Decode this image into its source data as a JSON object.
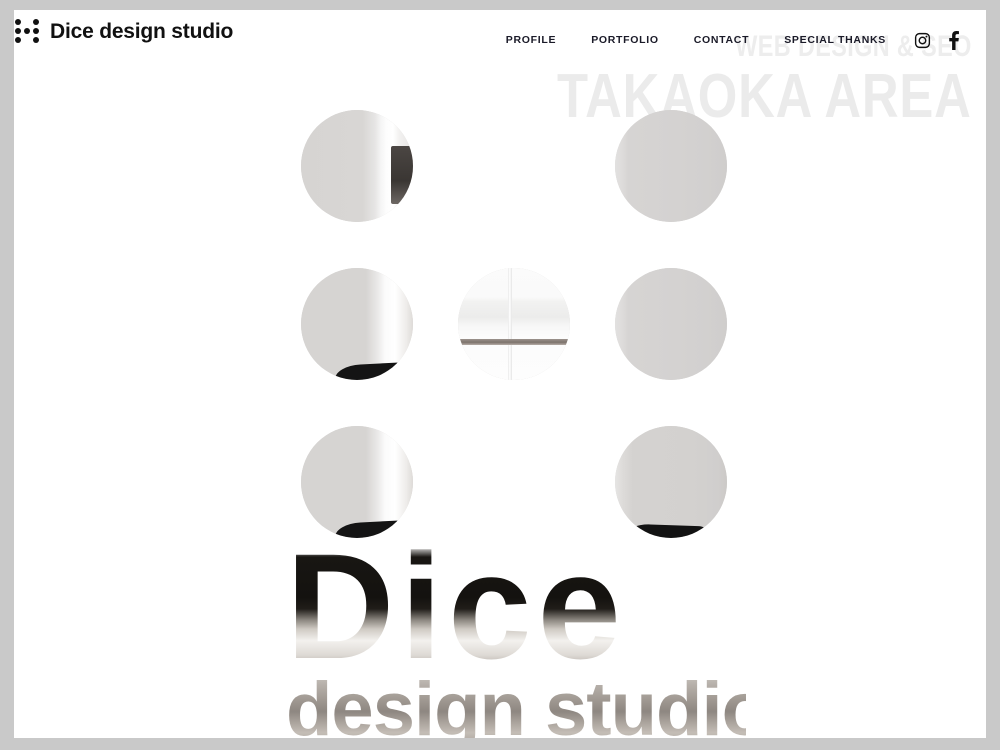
{
  "site": {
    "brand_name": "Dice design studio",
    "logo_icon": "dice-dots-icon"
  },
  "nav": {
    "items": [
      {
        "label": "PROFILE",
        "name": "nav-profile"
      },
      {
        "label": "PORTFOLIO",
        "name": "nav-portfolio"
      },
      {
        "label": "CONTACT",
        "name": "nav-contact"
      },
      {
        "label": "SPECIAL THANKS",
        "name": "nav-special-thanks"
      }
    ],
    "social": [
      {
        "label": "Instagram",
        "icon": "instagram-icon"
      },
      {
        "label": "Facebook",
        "icon": "facebook-icon"
      }
    ]
  },
  "hero": {
    "tagline_small": "WEB DESIGN & SEO",
    "tagline_large": "TAKAOKA AREA",
    "wordmark_primary": "Dice",
    "wordmark_secondary": "design studio"
  },
  "gallery": {
    "label": "circle-photo-grid",
    "circles": [
      {
        "position": "top-left",
        "alt": "interior wall and doorway"
      },
      {
        "position": "top-right",
        "alt": "plain light grey wall"
      },
      {
        "position": "middle-left",
        "alt": "white wall with window edge"
      },
      {
        "position": "middle-center",
        "alt": "white shelving and window frame"
      },
      {
        "position": "middle-right",
        "alt": "plain light grey wall"
      },
      {
        "position": "bottom-left",
        "alt": "wall with black chair back"
      },
      {
        "position": "bottom-right",
        "alt": "wall with black chair seat"
      }
    ]
  },
  "colors": {
    "page_background": "#ffffff",
    "frame": "#c9c9c9",
    "text_dark": "#111111",
    "nav_text": "#1a1a28",
    "hero_ghost_text": "#ececec",
    "circle_grey": "#d5d3d1"
  }
}
